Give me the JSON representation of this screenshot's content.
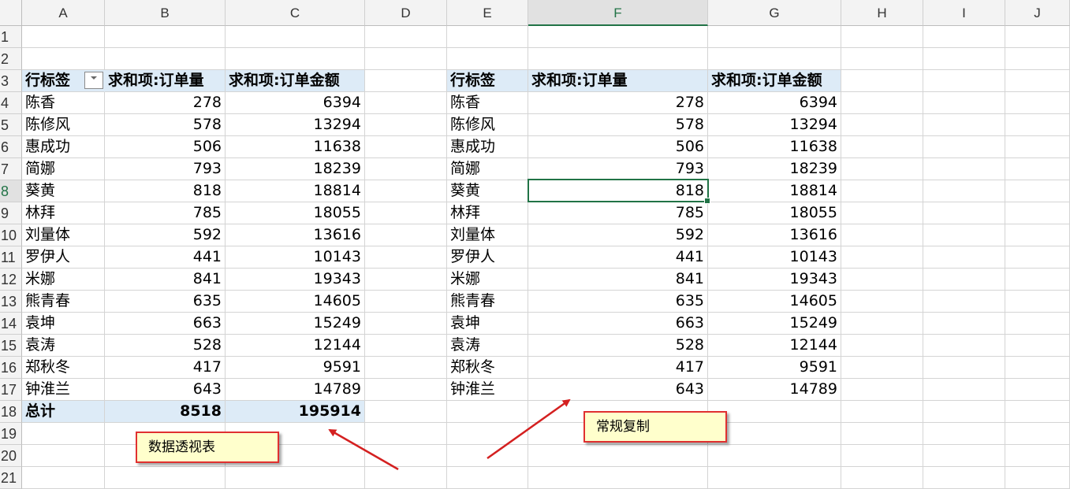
{
  "columns": [
    "A",
    "B",
    "C",
    "D",
    "E",
    "F",
    "G",
    "H",
    "I",
    "J"
  ],
  "active_column": "F",
  "active_row": 8,
  "rows": [
    "1",
    "2",
    "3",
    "4",
    "5",
    "6",
    "7",
    "8",
    "9",
    "10",
    "11",
    "12",
    "13",
    "14",
    "15",
    "16",
    "17",
    "18",
    "19",
    "20",
    "21"
  ],
  "pivot": {
    "headers": [
      "行标签",
      "求和项:订单量",
      "求和项:订单金额"
    ],
    "filter_icon": "dropdown-filter-icon",
    "rows": [
      [
        "陈香",
        "278",
        "6394"
      ],
      [
        "陈修风",
        "578",
        "13294"
      ],
      [
        "惠成功",
        "506",
        "11638"
      ],
      [
        "简娜",
        "793",
        "18239"
      ],
      [
        "葵黄",
        "818",
        "18814"
      ],
      [
        "林拜",
        "785",
        "18055"
      ],
      [
        "刘量体",
        "592",
        "13616"
      ],
      [
        "罗伊人",
        "441",
        "10143"
      ],
      [
        "米娜",
        "841",
        "19343"
      ],
      [
        "熊青春",
        "635",
        "14605"
      ],
      [
        "袁坤",
        "663",
        "15249"
      ],
      [
        "袁涛",
        "528",
        "12144"
      ],
      [
        "郑秋冬",
        "417",
        "9591"
      ],
      [
        "钟淮兰",
        "643",
        "14789"
      ]
    ],
    "total": [
      "总计",
      "8518",
      "195914"
    ]
  },
  "copy": {
    "headers": [
      "行标签",
      "求和项:订单量",
      "求和项:订单金额"
    ],
    "rows": [
      [
        "陈香",
        "278",
        "6394"
      ],
      [
        "陈修风",
        "578",
        "13294"
      ],
      [
        "惠成功",
        "506",
        "11638"
      ],
      [
        "简娜",
        "793",
        "18239"
      ],
      [
        "葵黄",
        "818",
        "18814"
      ],
      [
        "林拜",
        "785",
        "18055"
      ],
      [
        "刘量体",
        "592",
        "13616"
      ],
      [
        "罗伊人",
        "441",
        "10143"
      ],
      [
        "米娜",
        "841",
        "19343"
      ],
      [
        "熊青春",
        "635",
        "14605"
      ],
      [
        "袁坤",
        "663",
        "15249"
      ],
      [
        "袁涛",
        "528",
        "12144"
      ],
      [
        "郑秋冬",
        "417",
        "9591"
      ],
      [
        "钟淮兰",
        "643",
        "14789"
      ]
    ]
  },
  "callouts": {
    "pivot_label": "数据透视表",
    "copy_label": "常规复制",
    "border_color": "#e03030",
    "fill_color": "#ffffcc"
  },
  "colors": {
    "header_fill": "#ddebf7",
    "selection": "#217346"
  }
}
